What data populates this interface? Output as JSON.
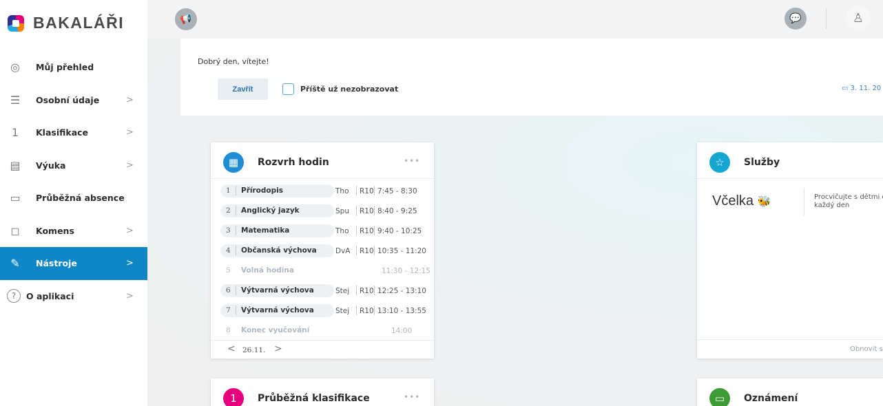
{
  "app": {
    "name": "BAKALÁŘI"
  },
  "sidebar": {
    "items": [
      {
        "label": "Můj přehled",
        "icon": "gauge-icon",
        "has_chevron": false,
        "active": false
      },
      {
        "label": "Osobní údaje",
        "icon": "person-list-icon",
        "has_chevron": true,
        "active": false
      },
      {
        "label": "Klasifikace",
        "icon": "grade-one-icon",
        "has_chevron": true,
        "active": false
      },
      {
        "label": "Výuka",
        "icon": "book-search-icon",
        "has_chevron": true,
        "active": false
      },
      {
        "label": "Průběžná absence",
        "icon": "absence-card-icon",
        "has_chevron": false,
        "active": false
      },
      {
        "label": "Komens",
        "icon": "chat-bubble-icon",
        "has_chevron": true,
        "active": false
      },
      {
        "label": "Nástroje",
        "icon": "wrench-icon",
        "has_chevron": true,
        "active": true
      },
      {
        "label": "O aplikaci",
        "icon": "question-circle-icon",
        "has_chevron": true,
        "active": false
      }
    ],
    "chevron": ">"
  },
  "topbar": {
    "megaphone": "📢",
    "chat": "💬",
    "user": "♙"
  },
  "welcome": {
    "text": "Dobrý den, vítejte!",
    "close_label": "Zavřít",
    "checkbox_label": "Příště už nezobrazovat",
    "date": "3. 11. 20"
  },
  "timetable": {
    "title": "Rozvrh hodin",
    "menu": "•••",
    "rows": [
      {
        "num": "1",
        "subject": "Přírodopis",
        "teacher": "Tho",
        "room": "R10",
        "time": "7:45 - 8:30",
        "muted": false
      },
      {
        "num": "2",
        "subject": "Anglický jazyk",
        "teacher": "Spu",
        "room": "R10",
        "time": "8:40 - 9:25",
        "muted": false
      },
      {
        "num": "3",
        "subject": "Matematika",
        "teacher": "Tho",
        "room": "R10",
        "time": "9:40 - 10:25",
        "muted": false
      },
      {
        "num": "4",
        "subject": "Občanská výchova",
        "teacher": "DvA",
        "room": "R10",
        "time": "10:35 - 11:20",
        "muted": false
      },
      {
        "num": "5",
        "subject": "Volná hodina",
        "teacher": "",
        "room": "",
        "time": "11:30 - 12:15",
        "muted": true
      },
      {
        "num": "6",
        "subject": "Výtvarná výchova",
        "teacher": "Stej",
        "room": "R10",
        "time": "12:25 - 13:10",
        "muted": false
      },
      {
        "num": "7",
        "subject": "Výtvarná výchova",
        "teacher": "Stej",
        "room": "R10",
        "time": "13:10 - 13:55",
        "muted": false
      },
      {
        "num": "8",
        "subject": "Konec vyučování",
        "teacher": "",
        "room": "",
        "time": "14:00",
        "muted": true
      }
    ],
    "date": "26.11.",
    "prev": "<",
    "next": ">"
  },
  "services": {
    "title": "Služby",
    "brand": "Včelka",
    "description_line1": "Procvičujte s dětmi č",
    "description_line2": "každý den",
    "refresh": "Obnovit s"
  },
  "grades": {
    "title": "Průběžná klasifikace",
    "menu": "•••"
  },
  "announcements": {
    "title": "Oznámení"
  }
}
